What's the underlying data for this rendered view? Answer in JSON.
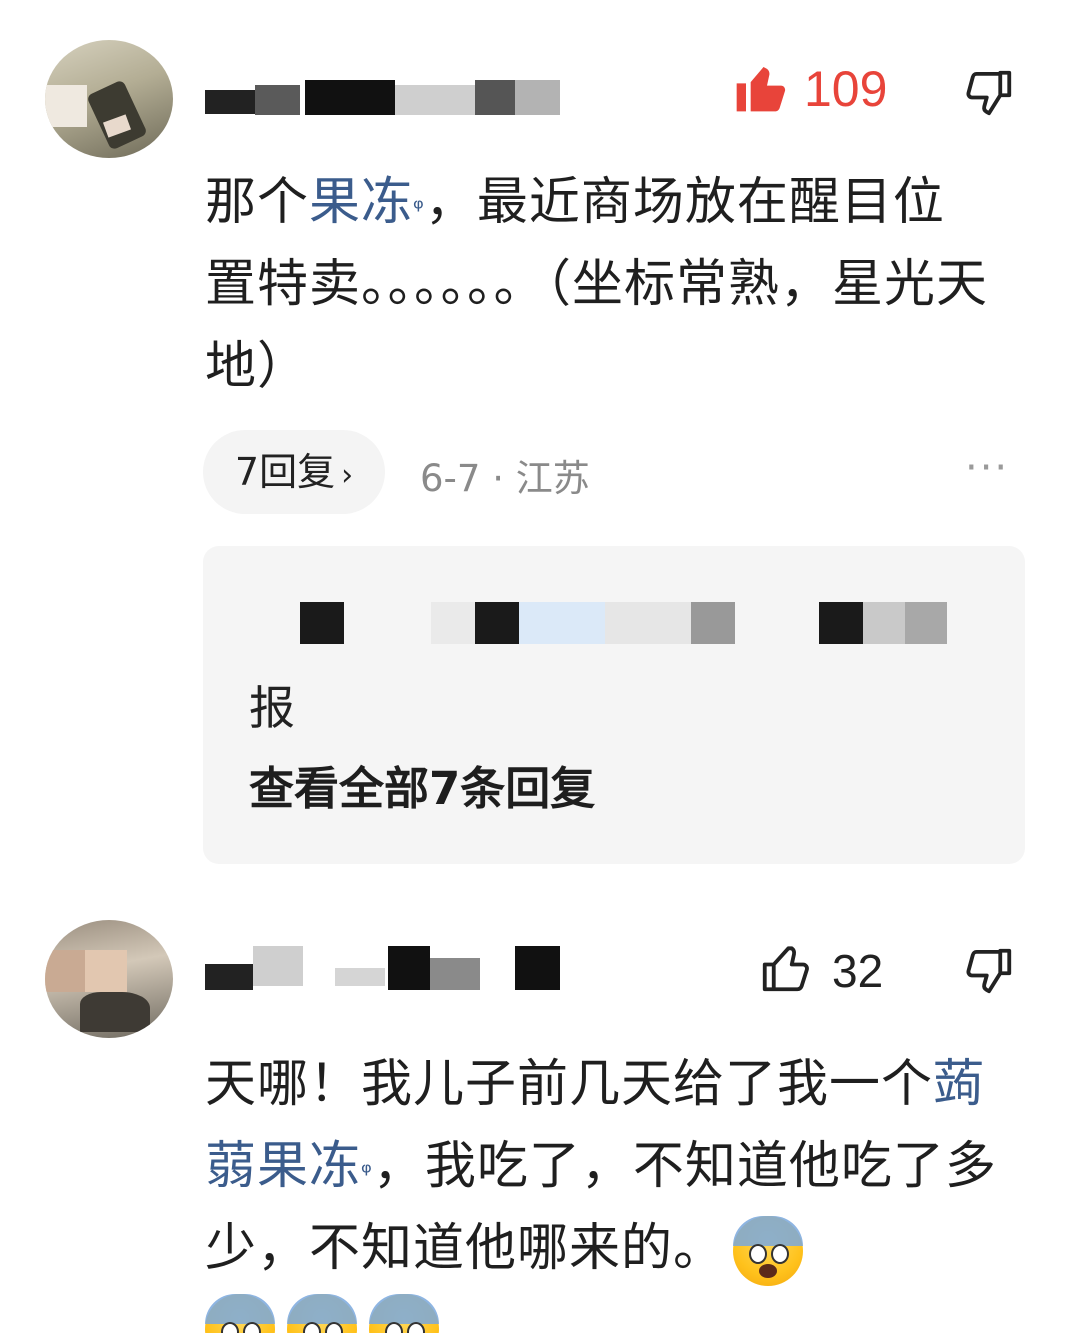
{
  "comments": [
    {
      "likes": "109",
      "liked": true,
      "text_parts": [
        "那个",
        "果冻",
        "，最近商场放在醒目位置特卖。。。。。。（坐标常熟，星光天地）"
      ],
      "reply_count_label": "7回复",
      "meta": "6-7 · 江苏",
      "more": "···",
      "reply_preview_tail": "报",
      "view_all_replies": "查看全部7条回复"
    },
    {
      "likes": "32",
      "liked": false,
      "text_parts": [
        "天哪！我儿子前几天给了我一个",
        "蒟蒻果冻",
        "，我吃了，不知道他吃了多少，不知道他哪来的。"
      ],
      "emoji_name": "face-screaming-in-fear"
    }
  ],
  "colors": {
    "link": "#3b5c8c",
    "like_active": "#e8443a",
    "meta_text": "#8a8a8a",
    "reply_box_bg": "#f5f5f5"
  },
  "icons": [
    "thumbs-up-filled-icon",
    "thumbs-down-icon",
    "thumbs-up-outline-icon",
    "search-hint-icon",
    "chevron-right-icon",
    "more-icon"
  ]
}
